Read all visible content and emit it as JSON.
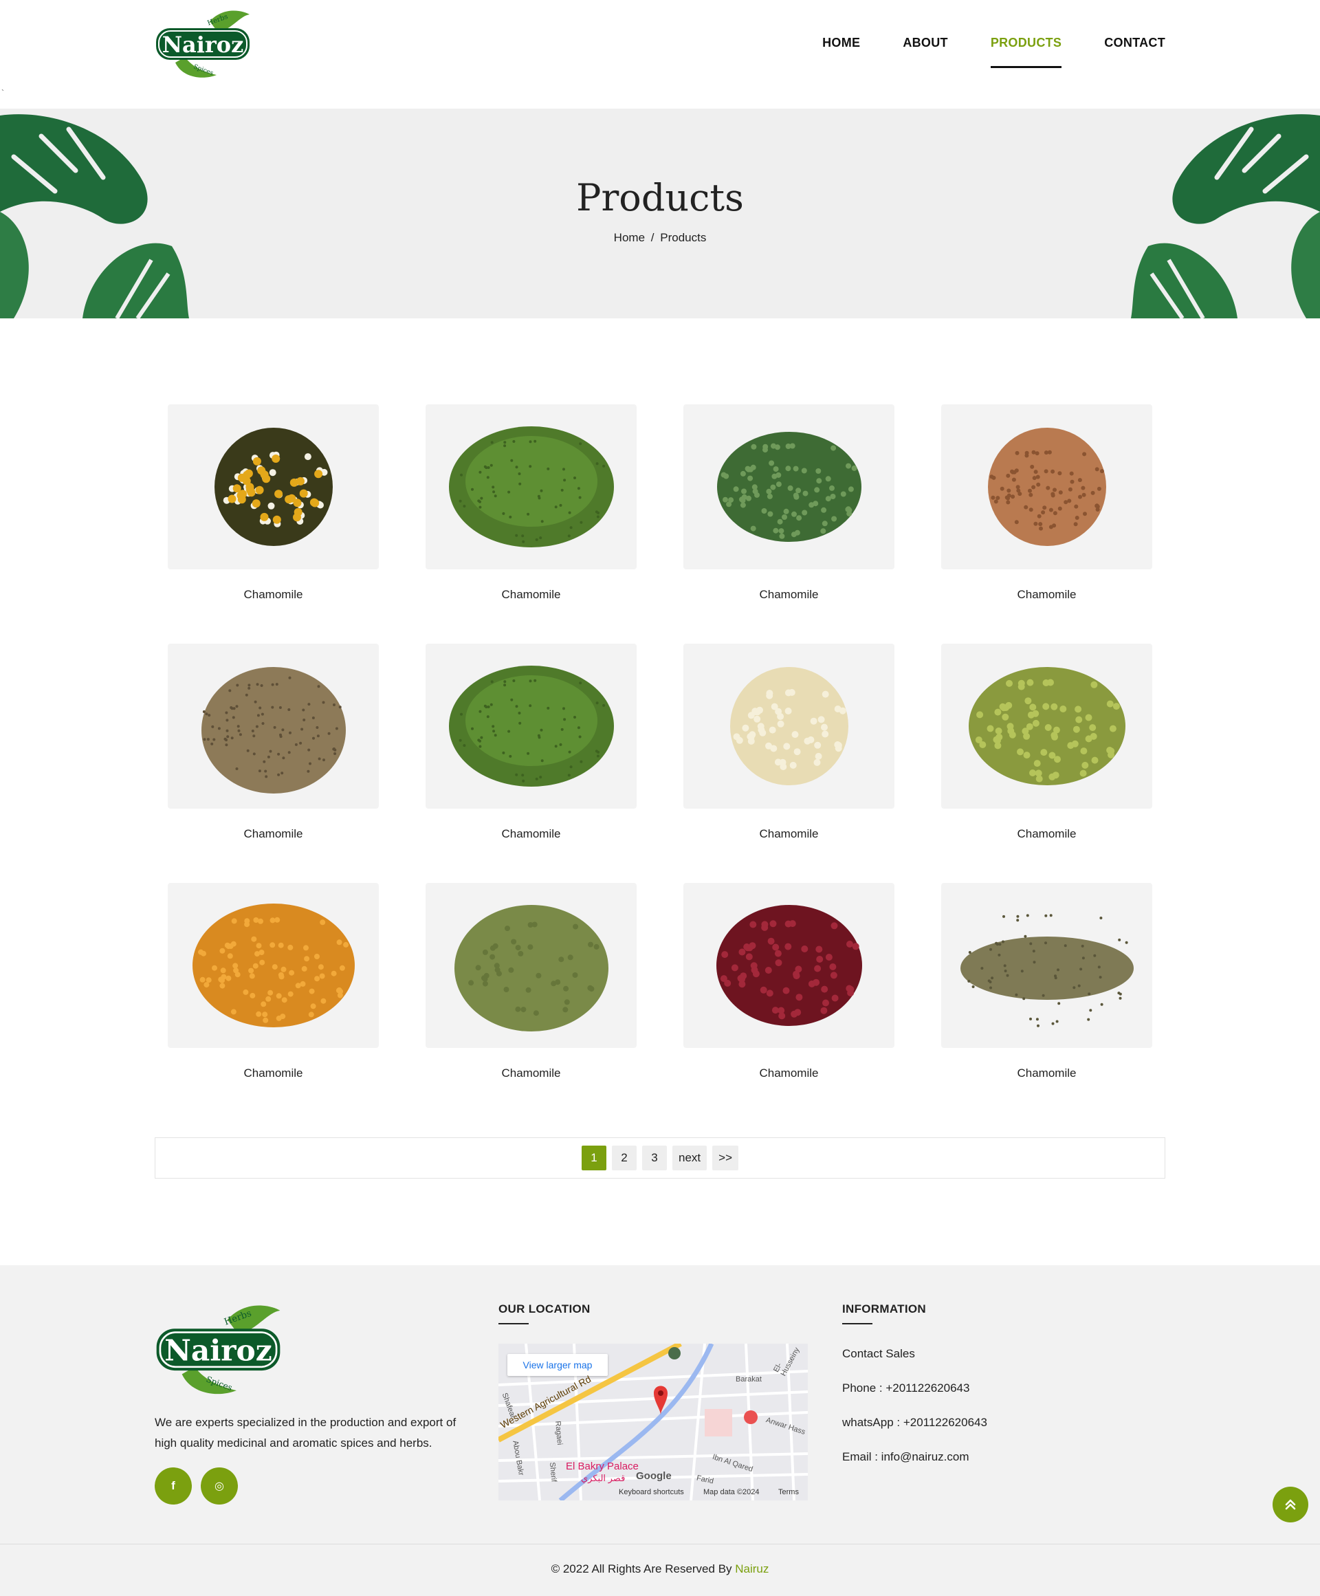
{
  "brand": {
    "logo_text": "Nairoz",
    "logo_top": "Herbs",
    "logo_bottom": "Spices"
  },
  "nav": {
    "items": [
      {
        "label": "HOME",
        "active": false
      },
      {
        "label": "ABOUT",
        "active": false
      },
      {
        "label": "PRODUCTS",
        "active": true
      },
      {
        "label": "CONTACT",
        "active": false
      }
    ]
  },
  "banner": {
    "title": "Products",
    "breadcrumb": [
      "Home",
      "Products"
    ],
    "separator": "/"
  },
  "products": [
    {
      "name": "Chamomile",
      "image": "chamomile-flowers"
    },
    {
      "name": "Chamomile",
      "image": "dill-herb"
    },
    {
      "name": "Chamomile",
      "image": "parsley-flakes"
    },
    {
      "name": "Chamomile",
      "image": "buckwheat-seeds"
    },
    {
      "name": "Chamomile",
      "image": "cumin-seeds"
    },
    {
      "name": "Chamomile",
      "image": "dill-herb"
    },
    {
      "name": "Chamomile",
      "image": "dried-onion"
    },
    {
      "name": "Chamomile",
      "image": "fennel-seeds"
    },
    {
      "name": "Chamomile",
      "image": "fenugreek-seeds"
    },
    {
      "name": "Chamomile",
      "image": "herb-powder"
    },
    {
      "name": "Chamomile",
      "image": "hibiscus"
    },
    {
      "name": "Chamomile",
      "image": "caraway-seeds"
    }
  ],
  "pagination": {
    "pages": [
      "1",
      "2",
      "3"
    ],
    "current": "1",
    "next": "next",
    "last": ">>"
  },
  "footer": {
    "about": "We are experts specialized in the production and export of high quality medicinal and aromatic spices and herbs.",
    "social": [
      {
        "icon": "facebook-icon",
        "glyph": "f"
      },
      {
        "icon": "instagram-icon",
        "glyph": "◎"
      }
    ],
    "location_title": "OUR LOCATION",
    "map": {
      "view_larger": "View larger map",
      "labels": {
        "road": "Western Agricultural Rd",
        "place": "El Bakry Palace",
        "place_ar": "قصر البكري",
        "barakat": "Barakat",
        "anwar": "Anwar Hass",
        "hussainy": "El-Husseiny",
        "ibn": "Ibn Al Qared",
        "farid": "Farid",
        "shafeai": "Shafeai",
        "abou_bakr": "Abou Bakr",
        "ragaei": "Ragaei",
        "sherif": "Sherif",
        "google": "Google",
        "shortcuts": "Keyboard shortcuts",
        "mapdata": "Map data ©2024",
        "terms": "Terms"
      }
    },
    "info_title": "INFORMATION",
    "contact_sales": "Contact Sales",
    "phone": "Phone : +201122620643",
    "whatsapp": "whatsApp : +201122620643",
    "email": "Email : info@nairuz.com",
    "copyright_prefix": "© 2022 All Rights Are Reserved By",
    "copyright_brand": "Nairuz"
  },
  "colors": {
    "accent": "#7ba00f",
    "banner_bg": "#efefef",
    "card_bg": "#f3f3f3",
    "footer_bg": "#f2f2f2"
  }
}
